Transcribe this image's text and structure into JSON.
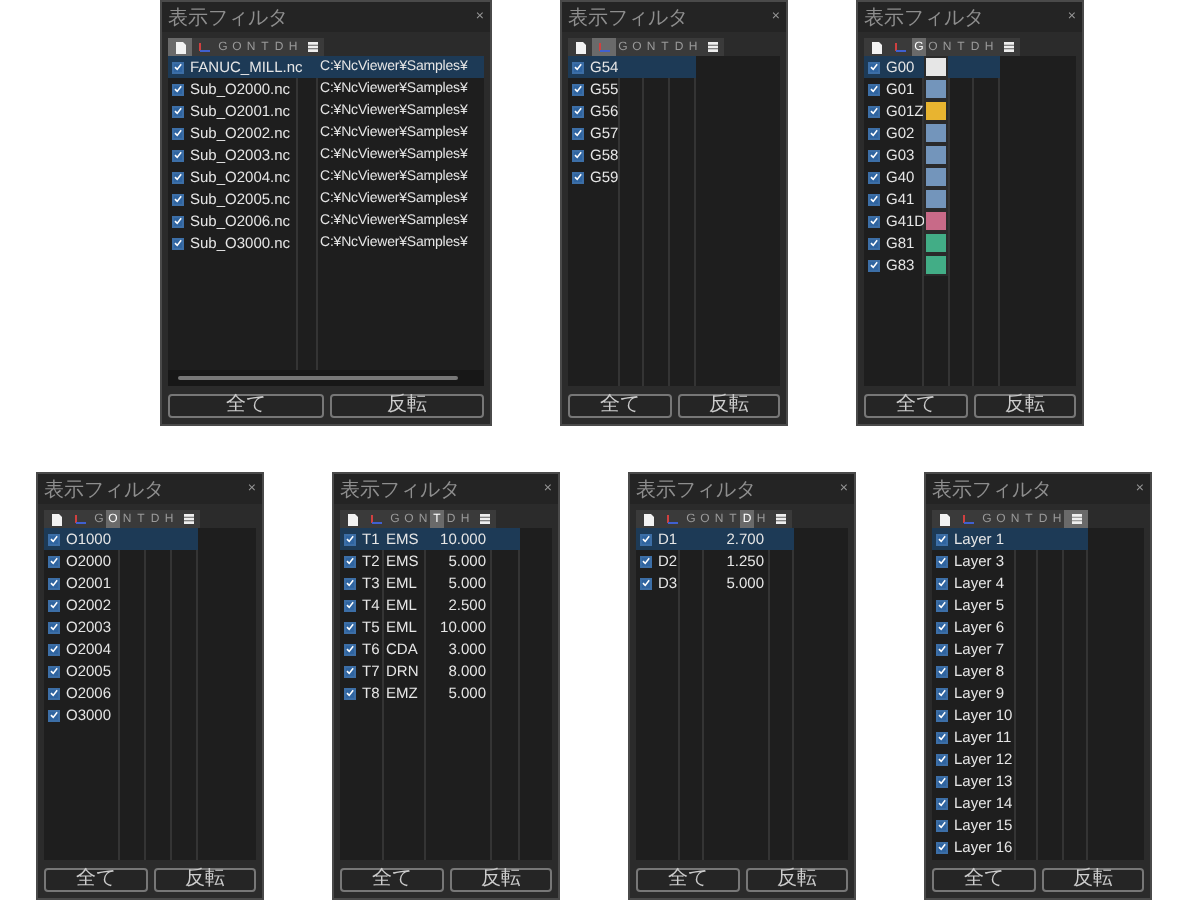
{
  "panels": [
    {
      "kind": "files",
      "title": "表示フィルタ",
      "close": "×",
      "tabs": [
        {
          "kind": "file",
          "selected": true
        },
        {
          "kind": "axes",
          "selected": false
        },
        {
          "kind": "letter",
          "label": "G",
          "selected": false
        },
        {
          "kind": "letter",
          "label": "O",
          "selected": false
        },
        {
          "kind": "letter",
          "label": "N",
          "selected": false
        },
        {
          "kind": "letter",
          "label": "T",
          "selected": false
        },
        {
          "kind": "letter",
          "label": "D",
          "selected": false
        },
        {
          "kind": "letter",
          "label": "H",
          "selected": false
        },
        {
          "kind": "layers",
          "selected": false
        }
      ],
      "rows": [
        {
          "checked": true,
          "selected": true,
          "cells": [
            "FANUC_MILL.nc",
            "C:¥NcViewer¥Samples¥"
          ]
        },
        {
          "checked": true,
          "selected": false,
          "cells": [
            "Sub_O2000.nc",
            "C:¥NcViewer¥Samples¥"
          ]
        },
        {
          "checked": true,
          "selected": false,
          "cells": [
            "Sub_O2001.nc",
            "C:¥NcViewer¥Samples¥"
          ]
        },
        {
          "checked": true,
          "selected": false,
          "cells": [
            "Sub_O2002.nc",
            "C:¥NcViewer¥Samples¥"
          ]
        },
        {
          "checked": true,
          "selected": false,
          "cells": [
            "Sub_O2003.nc",
            "C:¥NcViewer¥Samples¥"
          ]
        },
        {
          "checked": true,
          "selected": false,
          "cells": [
            "Sub_O2004.nc",
            "C:¥NcViewer¥Samples¥"
          ]
        },
        {
          "checked": true,
          "selected": false,
          "cells": [
            "Sub_O2005.nc",
            "C:¥NcViewer¥Samples¥"
          ]
        },
        {
          "checked": true,
          "selected": false,
          "cells": [
            "Sub_O2006.nc",
            "C:¥NcViewer¥Samples¥"
          ]
        },
        {
          "checked": true,
          "selected": false,
          "cells": [
            "Sub_O3000.nc",
            "C:¥NcViewer¥Samples¥"
          ]
        }
      ],
      "buttons": [
        "全て",
        "反転"
      ]
    },
    {
      "kind": "work",
      "title": "表示フィルタ",
      "close": "×",
      "tabs": [
        {
          "kind": "file",
          "selected": false
        },
        {
          "kind": "axes",
          "selected": true
        },
        {
          "kind": "letter",
          "label": "G",
          "selected": false
        },
        {
          "kind": "letter",
          "label": "O",
          "selected": false
        },
        {
          "kind": "letter",
          "label": "N",
          "selected": false
        },
        {
          "kind": "letter",
          "label": "T",
          "selected": false
        },
        {
          "kind": "letter",
          "label": "D",
          "selected": false
        },
        {
          "kind": "letter",
          "label": "H",
          "selected": false
        },
        {
          "kind": "layers",
          "selected": false
        }
      ],
      "rows": [
        {
          "checked": true,
          "selected": true,
          "cells": [
            "G54"
          ]
        },
        {
          "checked": true,
          "selected": false,
          "cells": [
            "G55"
          ]
        },
        {
          "checked": true,
          "selected": false,
          "cells": [
            "G56"
          ]
        },
        {
          "checked": true,
          "selected": false,
          "cells": [
            "G57"
          ]
        },
        {
          "checked": true,
          "selected": false,
          "cells": [
            "G58"
          ]
        },
        {
          "checked": true,
          "selected": false,
          "cells": [
            "G59"
          ]
        }
      ],
      "buttons": [
        "全て",
        "反転"
      ]
    },
    {
      "kind": "gcode",
      "title": "表示フィルタ",
      "close": "×",
      "tabs": [
        {
          "kind": "file",
          "selected": false
        },
        {
          "kind": "axes",
          "selected": false
        },
        {
          "kind": "letter",
          "label": "G",
          "selected": true
        },
        {
          "kind": "letter",
          "label": "O",
          "selected": false
        },
        {
          "kind": "letter",
          "label": "N",
          "selected": false
        },
        {
          "kind": "letter",
          "label": "T",
          "selected": false
        },
        {
          "kind": "letter",
          "label": "D",
          "selected": false
        },
        {
          "kind": "letter",
          "label": "H",
          "selected": false
        },
        {
          "kind": "layers",
          "selected": false
        }
      ],
      "rows": [
        {
          "checked": true,
          "selected": true,
          "cells": [
            "G00"
          ],
          "color": "#e6e6e6"
        },
        {
          "checked": true,
          "selected": false,
          "cells": [
            "G01"
          ],
          "color": "#7395bb"
        },
        {
          "checked": true,
          "selected": false,
          "cells": [
            "G01Z"
          ],
          "color": "#e8b430"
        },
        {
          "checked": true,
          "selected": false,
          "cells": [
            "G02"
          ],
          "color": "#7395bb"
        },
        {
          "checked": true,
          "selected": false,
          "cells": [
            "G03"
          ],
          "color": "#7395bb"
        },
        {
          "checked": true,
          "selected": false,
          "cells": [
            "G40"
          ],
          "color": "#7395bb"
        },
        {
          "checked": true,
          "selected": false,
          "cells": [
            "G41"
          ],
          "color": "#7395bb"
        },
        {
          "checked": true,
          "selected": false,
          "cells": [
            "G41D"
          ],
          "color": "#c86a88"
        },
        {
          "checked": true,
          "selected": false,
          "cells": [
            "G81"
          ],
          "color": "#42ad86"
        },
        {
          "checked": true,
          "selected": false,
          "cells": [
            "G83"
          ],
          "color": "#42ad86"
        }
      ],
      "buttons": [
        "全て",
        "反転"
      ]
    },
    {
      "kind": "programs",
      "title": "表示フィルタ",
      "close": "×",
      "tabs": [
        {
          "kind": "file",
          "selected": false
        },
        {
          "kind": "axes",
          "selected": false
        },
        {
          "kind": "letter",
          "label": "G",
          "selected": false
        },
        {
          "kind": "letter",
          "label": "O",
          "selected": true
        },
        {
          "kind": "letter",
          "label": "N",
          "selected": false
        },
        {
          "kind": "letter",
          "label": "T",
          "selected": false
        },
        {
          "kind": "letter",
          "label": "D",
          "selected": false
        },
        {
          "kind": "letter",
          "label": "H",
          "selected": false
        },
        {
          "kind": "layers",
          "selected": false
        }
      ],
      "rows": [
        {
          "checked": true,
          "selected": true,
          "cells": [
            "O1000"
          ]
        },
        {
          "checked": true,
          "selected": false,
          "cells": [
            "O2000"
          ]
        },
        {
          "checked": true,
          "selected": false,
          "cells": [
            "O2001"
          ]
        },
        {
          "checked": true,
          "selected": false,
          "cells": [
            "O2002"
          ]
        },
        {
          "checked": true,
          "selected": false,
          "cells": [
            "O2003"
          ]
        },
        {
          "checked": true,
          "selected": false,
          "cells": [
            "O2004"
          ]
        },
        {
          "checked": true,
          "selected": false,
          "cells": [
            "O2005"
          ]
        },
        {
          "checked": true,
          "selected": false,
          "cells": [
            "O2006"
          ]
        },
        {
          "checked": true,
          "selected": false,
          "cells": [
            "O3000"
          ]
        }
      ],
      "buttons": [
        "全て",
        "反転"
      ]
    },
    {
      "kind": "tools",
      "title": "表示フィルタ",
      "close": "×",
      "tabs": [
        {
          "kind": "file",
          "selected": false
        },
        {
          "kind": "axes",
          "selected": false
        },
        {
          "kind": "letter",
          "label": "G",
          "selected": false
        },
        {
          "kind": "letter",
          "label": "O",
          "selected": false
        },
        {
          "kind": "letter",
          "label": "N",
          "selected": false
        },
        {
          "kind": "letter",
          "label": "T",
          "selected": true
        },
        {
          "kind": "letter",
          "label": "D",
          "selected": false
        },
        {
          "kind": "letter",
          "label": "H",
          "selected": false
        },
        {
          "kind": "layers",
          "selected": false
        }
      ],
      "rows": [
        {
          "checked": true,
          "selected": true,
          "cells": [
            "T1",
            "EMS",
            "10.000"
          ]
        },
        {
          "checked": true,
          "selected": false,
          "cells": [
            "T2",
            "EMS",
            "5.000"
          ]
        },
        {
          "checked": true,
          "selected": false,
          "cells": [
            "T3",
            "EML",
            "5.000"
          ]
        },
        {
          "checked": true,
          "selected": false,
          "cells": [
            "T4",
            "EML",
            "2.500"
          ]
        },
        {
          "checked": true,
          "selected": false,
          "cells": [
            "T5",
            "EML",
            "10.000"
          ]
        },
        {
          "checked": true,
          "selected": false,
          "cells": [
            "T6",
            "CDA",
            "3.000"
          ]
        },
        {
          "checked": true,
          "selected": false,
          "cells": [
            "T7",
            "DRN",
            "8.000"
          ]
        },
        {
          "checked": true,
          "selected": false,
          "cells": [
            "T8",
            "EMZ",
            "5.000"
          ]
        }
      ],
      "buttons": [
        "全て",
        "反転"
      ]
    },
    {
      "kind": "diameters",
      "title": "表示フィルタ",
      "close": "×",
      "tabs": [
        {
          "kind": "file",
          "selected": false
        },
        {
          "kind": "axes",
          "selected": false
        },
        {
          "kind": "letter",
          "label": "G",
          "selected": false
        },
        {
          "kind": "letter",
          "label": "O",
          "selected": false
        },
        {
          "kind": "letter",
          "label": "N",
          "selected": false
        },
        {
          "kind": "letter",
          "label": "T",
          "selected": false
        },
        {
          "kind": "letter",
          "label": "D",
          "selected": true
        },
        {
          "kind": "letter",
          "label": "H",
          "selected": false
        },
        {
          "kind": "layers",
          "selected": false
        }
      ],
      "rows": [
        {
          "checked": true,
          "selected": true,
          "cells": [
            "D1",
            "2.700"
          ]
        },
        {
          "checked": true,
          "selected": false,
          "cells": [
            "D2",
            "1.250"
          ]
        },
        {
          "checked": true,
          "selected": false,
          "cells": [
            "D3",
            "5.000"
          ]
        }
      ],
      "buttons": [
        "全て",
        "反転"
      ]
    },
    {
      "kind": "layers",
      "title": "表示フィルタ",
      "close": "×",
      "tabs": [
        {
          "kind": "file",
          "selected": false
        },
        {
          "kind": "axes",
          "selected": false
        },
        {
          "kind": "letter",
          "label": "G",
          "selected": false
        },
        {
          "kind": "letter",
          "label": "O",
          "selected": false
        },
        {
          "kind": "letter",
          "label": "N",
          "selected": false
        },
        {
          "kind": "letter",
          "label": "T",
          "selected": false
        },
        {
          "kind": "letter",
          "label": "D",
          "selected": false
        },
        {
          "kind": "letter",
          "label": "H",
          "selected": false
        },
        {
          "kind": "layers",
          "selected": true
        }
      ],
      "rows": [
        {
          "checked": true,
          "selected": true,
          "cells": [
            "Layer 1"
          ]
        },
        {
          "checked": true,
          "selected": false,
          "cells": [
            "Layer 3"
          ]
        },
        {
          "checked": true,
          "selected": false,
          "cells": [
            "Layer 4"
          ]
        },
        {
          "checked": true,
          "selected": false,
          "cells": [
            "Layer 5"
          ]
        },
        {
          "checked": true,
          "selected": false,
          "cells": [
            "Layer 6"
          ]
        },
        {
          "checked": true,
          "selected": false,
          "cells": [
            "Layer 7"
          ]
        },
        {
          "checked": true,
          "selected": false,
          "cells": [
            "Layer 8"
          ]
        },
        {
          "checked": true,
          "selected": false,
          "cells": [
            "Layer 9"
          ]
        },
        {
          "checked": true,
          "selected": false,
          "cells": [
            "Layer 10"
          ]
        },
        {
          "checked": true,
          "selected": false,
          "cells": [
            "Layer 11"
          ]
        },
        {
          "checked": true,
          "selected": false,
          "cells": [
            "Layer 12"
          ]
        },
        {
          "checked": true,
          "selected": false,
          "cells": [
            "Layer 13"
          ]
        },
        {
          "checked": true,
          "selected": false,
          "cells": [
            "Layer 14"
          ]
        },
        {
          "checked": true,
          "selected": false,
          "cells": [
            "Layer 15"
          ]
        },
        {
          "checked": true,
          "selected": false,
          "cells": [
            "Layer 16"
          ]
        }
      ],
      "buttons": [
        "全て",
        "反転"
      ]
    }
  ]
}
